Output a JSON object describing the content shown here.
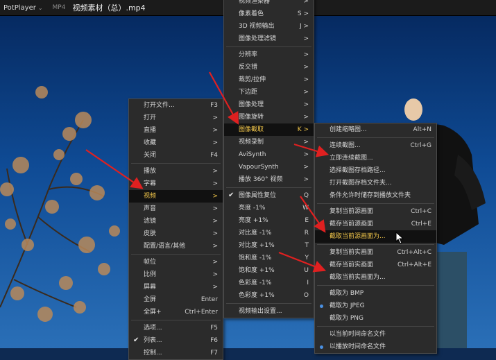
{
  "titlebar": {
    "app_name": "PotPlayer",
    "format": "MP4",
    "file_title": "视频素材（总）.mp4"
  },
  "colors": {
    "accent": "#f2c64a",
    "arrow": "#e02020",
    "radio": "#4a90e2"
  },
  "main_menu": {
    "items": [
      {
        "label": "打开文件...",
        "shortcut": "F3"
      },
      {
        "label": "打开",
        "shortcut": ">"
      },
      {
        "label": "直播",
        "shortcut": ">"
      },
      {
        "label": "收藏",
        "shortcut": ">"
      },
      {
        "label": "关闭",
        "shortcut": "F4"
      },
      {
        "sep": true
      },
      {
        "label": "播放",
        "shortcut": ">"
      },
      {
        "label": "字幕",
        "shortcut": ">"
      },
      {
        "label": "视频",
        "shortcut": ">",
        "selected": true
      },
      {
        "label": "声音",
        "shortcut": ">"
      },
      {
        "label": "滤镜",
        "shortcut": ">"
      },
      {
        "label": "皮肤",
        "shortcut": ">"
      },
      {
        "label": "配置/语言/其他",
        "shortcut": ">"
      },
      {
        "sep": true
      },
      {
        "label": "帧位",
        "shortcut": ">"
      },
      {
        "label": "比例",
        "shortcut": ">"
      },
      {
        "label": "屏幕",
        "shortcut": ">"
      },
      {
        "label": "全屏",
        "shortcut": "Enter"
      },
      {
        "label": "全屏+",
        "shortcut": "Ctrl+Enter"
      },
      {
        "sep": true
      },
      {
        "label": "选项...",
        "shortcut": "F5"
      },
      {
        "label": "列表...",
        "shortcut": "F6",
        "checked": true
      },
      {
        "label": "控制...",
        "shortcut": "F7"
      }
    ]
  },
  "video_menu": {
    "items": [
      {
        "label": "视频渲染器",
        "shortcut": ">"
      },
      {
        "label": "像素着色",
        "shortcut": "S >"
      },
      {
        "label": "3D 视频输出",
        "shortcut": "J >"
      },
      {
        "label": "图像处理滤镜",
        "shortcut": ">"
      },
      {
        "sep": true
      },
      {
        "label": "分辨率",
        "shortcut": ">"
      },
      {
        "label": "反交错",
        "shortcut": ">"
      },
      {
        "label": "裁剪/拉伸",
        "shortcut": ">"
      },
      {
        "label": "下边距",
        "shortcut": ">"
      },
      {
        "label": "图像处理",
        "shortcut": ">"
      },
      {
        "label": "图像旋转",
        "shortcut": ">"
      },
      {
        "label": "图像截取",
        "shortcut": "K >",
        "selected": true
      },
      {
        "label": "视频录制",
        "shortcut": ">"
      },
      {
        "label": "AviSynth",
        "shortcut": ">"
      },
      {
        "label": "VapourSynth",
        "shortcut": ">"
      },
      {
        "label": "播放 360° 视频",
        "shortcut": ">"
      },
      {
        "sep": true
      },
      {
        "label": "图像属性复位",
        "shortcut": "Q",
        "checked": true
      },
      {
        "label": "亮度 -1%",
        "shortcut": "W"
      },
      {
        "label": "亮度 +1%",
        "shortcut": "E"
      },
      {
        "label": "对比度 -1%",
        "shortcut": "R"
      },
      {
        "label": "对比度 +1%",
        "shortcut": "T"
      },
      {
        "label": "饱和度 -1%",
        "shortcut": "Y"
      },
      {
        "label": "饱和度 +1%",
        "shortcut": "U"
      },
      {
        "label": "色彩度 -1%",
        "shortcut": "I"
      },
      {
        "label": "色彩度 +1%",
        "shortcut": "O"
      },
      {
        "sep": true
      },
      {
        "label": "视频输出设置...",
        "shortcut": ""
      }
    ]
  },
  "capture_menu": {
    "items": [
      {
        "label": "创建缩略图...",
        "shortcut": "Alt+N"
      },
      {
        "sep": true
      },
      {
        "label": "连续截图...",
        "shortcut": "Ctrl+G"
      },
      {
        "label": "立即连续截图...",
        "shortcut": ""
      },
      {
        "label": "选择截图存档路径...",
        "shortcut": ""
      },
      {
        "label": "打开截图存档文件夹...",
        "shortcut": ""
      },
      {
        "label": "条件允许时储存到播放文件夹",
        "shortcut": ""
      },
      {
        "sep": true
      },
      {
        "label": "复制当前源画面",
        "shortcut": "Ctrl+C"
      },
      {
        "label": "截存当前源画面",
        "shortcut": "Ctrl+E"
      },
      {
        "label": "截取当前源画面为...",
        "shortcut": "",
        "selected": true
      },
      {
        "sep": true
      },
      {
        "label": "复制当前实画面",
        "shortcut": "Ctrl+Alt+C"
      },
      {
        "label": "截存当前实画面",
        "shortcut": "Ctrl+Alt+E"
      },
      {
        "label": "截取当前实画面为...",
        "shortcut": ""
      },
      {
        "sep": true
      },
      {
        "label": "截取为 BMP",
        "shortcut": ""
      },
      {
        "label": "截取为 JPEG",
        "shortcut": "",
        "radio": true
      },
      {
        "label": "截取为 PNG",
        "shortcut": ""
      },
      {
        "sep": true
      },
      {
        "label": "以当前时间命名文件",
        "shortcut": ""
      },
      {
        "label": "以播放时间命名文件",
        "shortcut": "",
        "radio": true
      }
    ]
  }
}
